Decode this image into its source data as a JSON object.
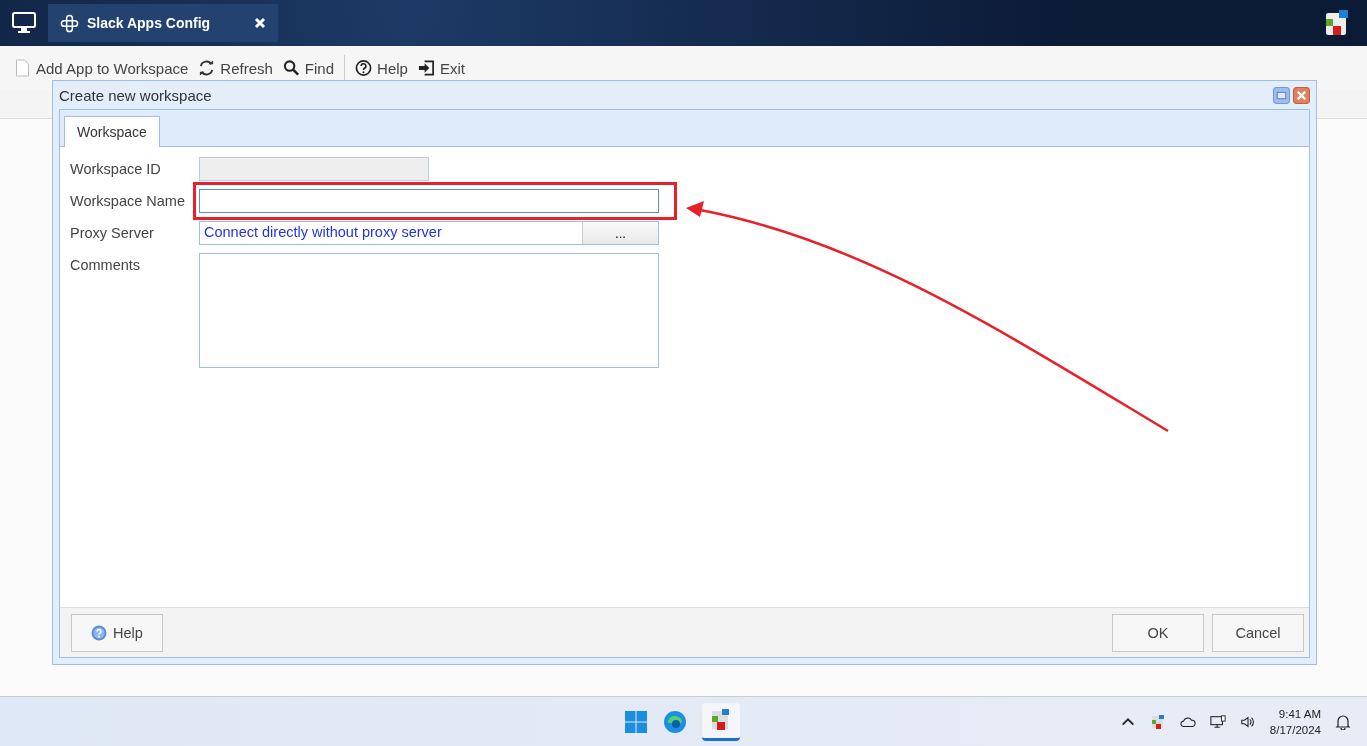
{
  "app_tab": {
    "title": "Slack Apps Config"
  },
  "toolbar": [
    {
      "label": "Add App to Workspace",
      "kind": "page"
    },
    {
      "label": "Refresh",
      "kind": "refresh"
    },
    {
      "label": "Find",
      "kind": "search"
    },
    {
      "label": "Help",
      "kind": "help"
    },
    {
      "label": "Exit",
      "kind": "exit"
    }
  ],
  "dialog": {
    "title": "Create new workspace",
    "tabs": [
      {
        "label": "Workspace",
        "selected": true
      }
    ],
    "fields": [
      {
        "label": "Workspace ID",
        "kind": "text",
        "disabled": true,
        "focused": false
      },
      {
        "label": "Workspace Name",
        "kind": "text",
        "disabled": false,
        "focused": true,
        "highlighted": true
      },
      {
        "label": "Proxy Server",
        "kind": "picker",
        "value": "Connect directly without proxy server",
        "button": "..."
      },
      {
        "label": "Comments",
        "kind": "memo"
      }
    ],
    "help_button": "Help",
    "buttons": [
      "OK",
      "Cancel"
    ]
  },
  "taskbar": {
    "time": "9:41 AM",
    "date": "8/17/2024"
  }
}
